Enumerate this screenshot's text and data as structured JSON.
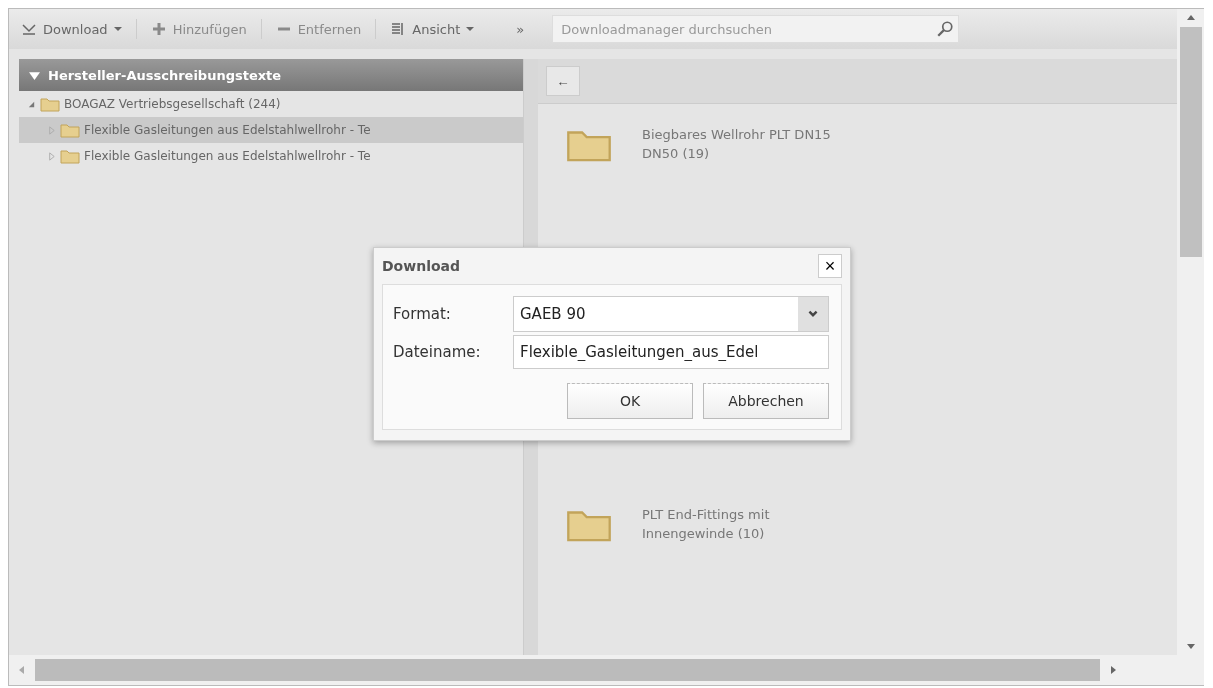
{
  "toolbar": {
    "buttons": [
      {
        "kind": "download",
        "label": "Download",
        "dropdown": true,
        "disabled": false
      },
      {
        "kind": "add",
        "label": "Hinzufügen",
        "dropdown": false,
        "disabled": true
      },
      {
        "kind": "remove",
        "label": "Entfernen",
        "dropdown": false,
        "disabled": true
      },
      {
        "kind": "view",
        "label": "Ansicht",
        "dropdown": true,
        "disabled": false
      }
    ],
    "overflow": "»",
    "search": {
      "placeholder": "Downloadmanager durchsuchen"
    }
  },
  "tree": {
    "title": "Hersteller-Ausschreibungstexte",
    "expanded": true,
    "items": [
      {
        "label": "BOAGAZ Vertriebsgesellschaft (244)",
        "expanded": true,
        "selected": false,
        "children": [
          {
            "label": "Flexible Gasleitungen aus Edelstahlwellrohr - Te",
            "expanded": false,
            "selected": true
          },
          {
            "label": "Flexible Gasleitungen aus Edelstahlwellrohr - Te",
            "expanded": false,
            "selected": false
          }
        ]
      }
    ]
  },
  "content": {
    "back": "←",
    "folders": [
      {
        "label": "Biegbares Wellrohr PLT DN15\nDN50 (19)"
      },
      {
        "label": "PLT End-Fittings mit\nInnengewinde (10)"
      }
    ]
  },
  "dialog": {
    "title": "Download",
    "close": "×",
    "fields": [
      {
        "kind": "select",
        "label": "Format:",
        "value": "GAEB 90"
      },
      {
        "kind": "text",
        "label": "Dateiname:",
        "value": "Flexible_Gasleitungen_aus_Edel"
      }
    ],
    "buttons": [
      "OK",
      "Abbrechen"
    ]
  }
}
